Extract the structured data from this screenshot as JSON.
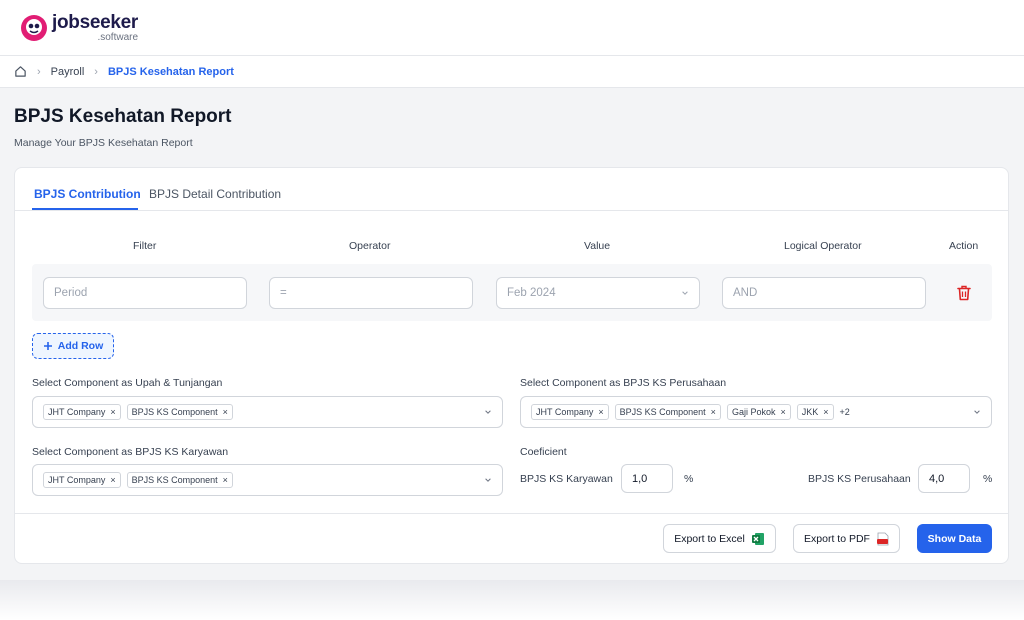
{
  "brand": {
    "name": "jobseeker",
    "sub": ".software",
    "colors": {
      "primary": "#2563eb",
      "logo_pink": "#e11d74",
      "logo_navy": "#1e1b4b"
    }
  },
  "breadcrumb": {
    "home_icon": "home-icon",
    "items": [
      "Payroll",
      "BPJS Kesehatan Report"
    ]
  },
  "page": {
    "title": "BPJS Kesehatan Report",
    "subtitle": "Manage Your BPJS Kesehatan Report"
  },
  "tabs": [
    {
      "label": "BPJS Contribution",
      "active": true
    },
    {
      "label": "BPJS Detail Contribution",
      "active": false
    }
  ],
  "filter_table": {
    "headers": {
      "filter": "Filter",
      "operator": "Operator",
      "value": "Value",
      "logical": "Logical Operator",
      "action": "Action"
    },
    "row": {
      "filter_placeholder": "Period",
      "operator_placeholder": "=",
      "value": "Feb 2024",
      "logical_placeholder": "AND",
      "action_icon": "trash-icon"
    }
  },
  "add_row_label": "Add Row",
  "upah": {
    "label": "Select Component as Upah & Tunjangan",
    "chips": [
      "JHT Company",
      "BPJS KS Component"
    ]
  },
  "perusahaan": {
    "label": "Select Component as BPJS KS Perusahaan",
    "chips": [
      "JHT Company",
      "BPJS KS Component",
      "Gaji Pokok",
      "JKK"
    ],
    "more": "+2"
  },
  "karyawan": {
    "label": "Select Component as BPJS KS Karyawan",
    "chips": [
      "JHT Company",
      "BPJS KS Component"
    ]
  },
  "coeficient": {
    "label": "Coeficient",
    "karyawan_label": "BPJS KS Karyawan",
    "karyawan_value": "1,0",
    "perusahaan_label": "BPJS KS Perusahaan",
    "perusahaan_value": "4,0",
    "unit": "%"
  },
  "actions": {
    "excel": "Export to Excel",
    "pdf": "Export to PDF",
    "show": "Show Data"
  }
}
